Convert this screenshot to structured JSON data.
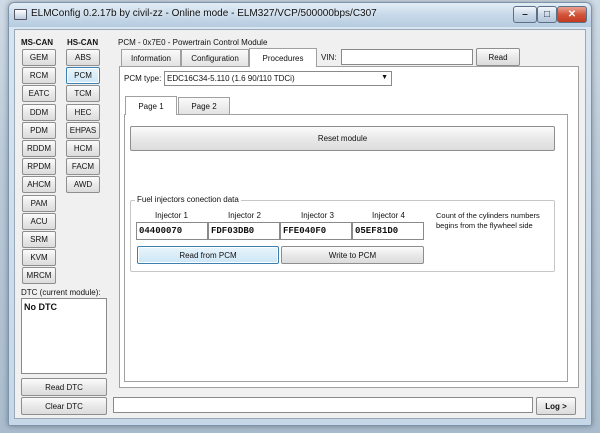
{
  "window": {
    "title": "ELMConfig 0.2.17b by civil-zz - Online mode - ELM327/VCP/500000bps/C307",
    "minimize_glyph": "–",
    "maximize_glyph": "□",
    "close_glyph": "✕"
  },
  "left": {
    "ms_can_header": "MS-CAN",
    "hs_can_header": "HS-CAN",
    "ms_can_modules": [
      "GEM",
      "RCM",
      "EATC",
      "DDM",
      "PDM",
      "RDDM",
      "RPDM",
      "AHCM",
      "PAM",
      "ACU",
      "SRM",
      "KVM",
      "MRCM"
    ],
    "hs_can_modules": [
      "ABS",
      "PCM",
      "TCM",
      "HEC",
      "EHPAS",
      "HCM",
      "FACM",
      "AWD"
    ],
    "selected_module": "PCM",
    "dtc_label": "DTC (current module):",
    "dtc_value": "No DTC",
    "read_dtc": "Read DTC",
    "clear_dtc": "Clear DTC"
  },
  "pcm": {
    "header": "PCM - 0x7E0 - Powertrain Control Module",
    "tabs": [
      "Information",
      "Configuration",
      "Procedures"
    ],
    "active_tab": "Procedures",
    "vin_label": "VIN:",
    "vin_value": "",
    "read_button": "Read",
    "pcm_type_label": "PCM type:",
    "pcm_type_value": "EDC16C34-5.110 (1.6 90/110 TDCi)",
    "pages": [
      "Page 1",
      "Page 2"
    ],
    "active_page": "Page 1",
    "reset_button": "Reset module",
    "injectors": {
      "group_title": "Fuel injectors conection data",
      "headers": [
        "Injector 1",
        "Injector 2",
        "Injector 3",
        "Injector 4"
      ],
      "values": [
        "04400070",
        "FDF03DB0",
        "FFE040F0",
        "05EF81D0"
      ],
      "note": "Count of the cylinders numbers begins from the flywheel side",
      "read_button": "Read from PCM",
      "write_button": "Write to PCM"
    }
  },
  "bottom": {
    "log_value": "",
    "log_button": "Log >"
  }
}
